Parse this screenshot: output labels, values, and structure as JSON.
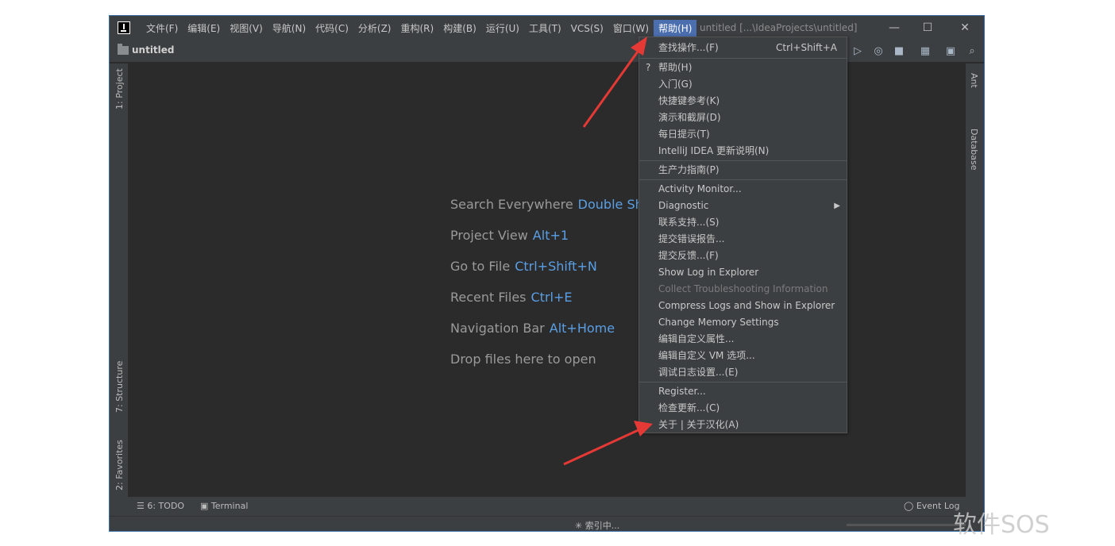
{
  "menubar": {
    "items": [
      "文件(F)",
      "编辑(E)",
      "视图(V)",
      "导航(N)",
      "代码(C)",
      "分析(Z)",
      "重构(R)",
      "构建(B)",
      "运行(U)",
      "工具(T)",
      "VCS(S)",
      "窗口(W)",
      "帮助(H)"
    ],
    "active_index": 12
  },
  "window": {
    "title": "untitled [...\\IdeaProjects\\untitled]",
    "minimize": "—",
    "maximize": "☐",
    "close": "✕"
  },
  "navbar": {
    "project": "untitled"
  },
  "left_tabs": [
    "1: Project",
    "7: Structure",
    "2: Favorites"
  ],
  "right_tabs": [
    "Ant",
    "Database"
  ],
  "editor_hints": [
    {
      "label": "Search Everywhere",
      "key": "Double Shi"
    },
    {
      "label": "Project View",
      "key": "Alt+1"
    },
    {
      "label": "Go to File",
      "key": "Ctrl+Shift+N"
    },
    {
      "label": "Recent Files",
      "key": "Ctrl+E"
    },
    {
      "label": "Navigation Bar",
      "key": "Alt+Home"
    },
    {
      "label": "Drop files here to open",
      "key": ""
    }
  ],
  "help_menu": {
    "find_action": "查找操作...(F)",
    "find_action_shortcut": "Ctrl+Shift+A",
    "items_group1": [
      "帮助(H)",
      "入门(G)",
      "快捷键参考(K)",
      "演示和截屏(D)",
      "每日提示(T)",
      "IntelliJ IDEA 更新说明(N)"
    ],
    "items_group2": [
      "生产力指南(P)"
    ],
    "items_group3": [
      "Activity Monitor...",
      "Diagnostic",
      "联系支持...(S)",
      "提交错误报告...",
      "提交反馈...(F)",
      "Show Log in Explorer",
      "Collect Troubleshooting Information",
      "Compress Logs and Show in Explorer",
      "Change Memory Settings",
      "编辑自定义属性...",
      "编辑自定义 VM 选项...",
      "调试日志设置...(E)"
    ],
    "items_group4": [
      "Register...",
      "检查更新...(C)",
      "关于 | 关于汉化(A)"
    ],
    "disabled_item": "Collect Troubleshooting Information",
    "submenu_item": "Diagnostic"
  },
  "bottom_tabs": {
    "todo": "6: TODO",
    "terminal": "Terminal",
    "event_log": "Event Log"
  },
  "status": {
    "indexing": "索引中..."
  },
  "watermark": "软件SOS",
  "colors": {
    "accent": "#4b6eaf",
    "link": "#5a9fe5",
    "arrow": "#e53935"
  }
}
